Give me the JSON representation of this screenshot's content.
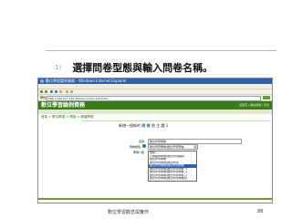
{
  "slide": {
    "step_number": "1)",
    "instruction": "選擇問卷型態與輸入問卷名稱。",
    "footer": "數位學習觀念與實作",
    "page_number": "88"
  },
  "browser": {
    "window_title": "數位學習論例資務 - Windows Internet Explorer",
    "menu_items": [
      "檔案",
      "編輯",
      "檢視",
      "我的最愛",
      "工具",
      "說明"
    ],
    "address_label": "網址",
    "url": "http://140.117.120.45/learn/index.php?sid=..."
  },
  "app": {
    "banner_title": "數位學習論例資務",
    "banner_links": "回首頁 | 網站導覽 | 登出",
    "breadcrumb": "首頁 > 數位學習 > 問卷 > 新增問卷",
    "panel_title_prefix": "新增一個新的",
    "panel_title_highlight": "問 卷",
    "panel_title_suffix": "到 主 題 1",
    "form": {
      "name_label": "名稱",
      "name_value": "數位學習問卷",
      "type_label": "問卷類型",
      "type_value": "數位學習問卷(數位學習問卷)",
      "intro_label": "問卷介紹",
      "options": [
        "選擇...",
        "行為觀察問卷(數位學習觀察)",
        "數位學習問卷",
        "數位學習問卷(數位學習)",
        "數位學習問卷(數位學習問卷)",
        "數位學習問卷(數位學習問卷一)",
        "數位學習問卷(數位學習問卷二)",
        "數位學習問卷(數位學習問卷三)",
        "數位學習問卷(數位學習問卷四)"
      ],
      "selected_option": "數位學習問卷(數位學習問卷)"
    }
  }
}
